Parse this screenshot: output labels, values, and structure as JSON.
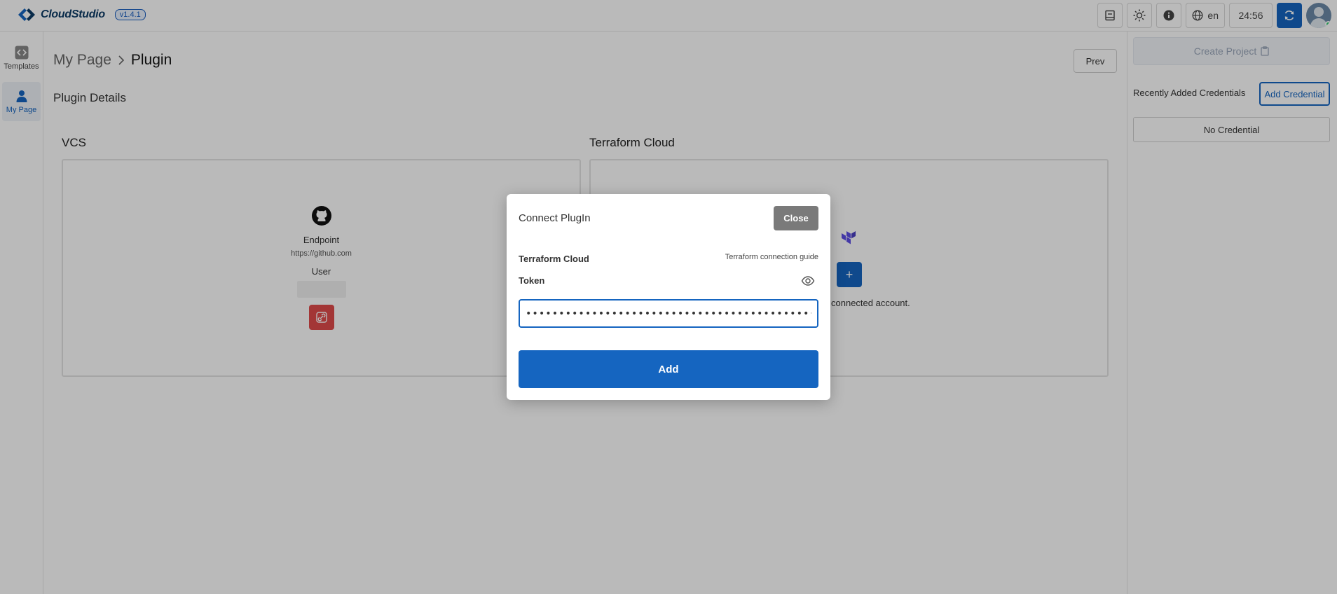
{
  "app": {
    "name": "CloudStudio",
    "version": "v1.4.1"
  },
  "header": {
    "language": "en",
    "timer": "24:56"
  },
  "leftnav": {
    "items": [
      {
        "label": "Templates"
      },
      {
        "label": "My Page"
      }
    ]
  },
  "breadcrumb": {
    "parent": "My Page",
    "current": "Plugin"
  },
  "main": {
    "prev_label": "Prev",
    "section_title": "Plugin Details",
    "vcs": {
      "title": "VCS",
      "endpoint_label": "Endpoint",
      "endpoint_value": "https://github.com",
      "user_label": "User"
    },
    "terraform": {
      "title": "Terraform Cloud",
      "message": "connected account."
    }
  },
  "rightpanel": {
    "create_label": "Create Project",
    "recent_label": "Recently Added Credentials",
    "add_credential_label": "Add Credential",
    "no_credential": "No Credential"
  },
  "modal": {
    "title": "Connect PlugIn",
    "close_label": "Close",
    "provider": "Terraform Cloud",
    "guide_link": "Terraform connection guide",
    "token_label": "Token",
    "token_value": "cs-token-0123456789abcdefghijklmnopqrstuvwxyzABCDEFGHIJKLMN",
    "add_label": "Add"
  },
  "colors": {
    "primary": "#1565c0",
    "danger": "#e04b4b",
    "terraform": "#5c4ee5",
    "close": "#7a7a7a"
  }
}
